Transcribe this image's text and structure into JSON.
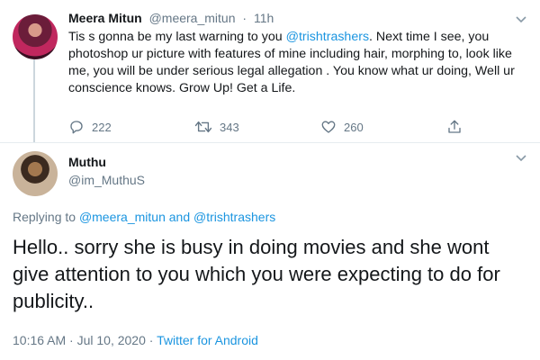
{
  "parent_tweet": {
    "name": "Meera Mitun",
    "handle": "@meera_mitun",
    "separator": "·",
    "time": "11h",
    "text_before": "Tis s gonna be my last warning to you ",
    "mention": "@trishtrashers",
    "text_after": ". Next time I see, you photoshop ur picture with features of mine including hair, morphing to, look like me, you will be under serious legal allegation . You know what ur doing, Well ur conscience knows. Grow Up! Get a Life.",
    "replies": "222",
    "retweets": "343",
    "likes": "260"
  },
  "reply_tweet": {
    "name": "Muthu",
    "handle": "@im_MuthuS",
    "replying_prefix": "Replying to ",
    "replying_mention_1": "@meera_mitun",
    "replying_and": " and ",
    "replying_mention_2": "@trishtrashers",
    "text": "Hello.. sorry she is busy in doing movies and she wont give attention to you which you were expecting to do for publicity..",
    "timestamp": "10:16 AM · Jul 10, 2020",
    "meta_separator": " · ",
    "source": "Twitter for Android"
  },
  "icons": {
    "reply": "reply-icon",
    "retweet": "retweet-icon",
    "like": "heart-icon",
    "share": "share-icon",
    "more": "chevron-down-icon"
  },
  "colors": {
    "link": "#1b95e0",
    "muted": "#657786",
    "text": "#14171a",
    "divider": "#e6ecf0"
  }
}
